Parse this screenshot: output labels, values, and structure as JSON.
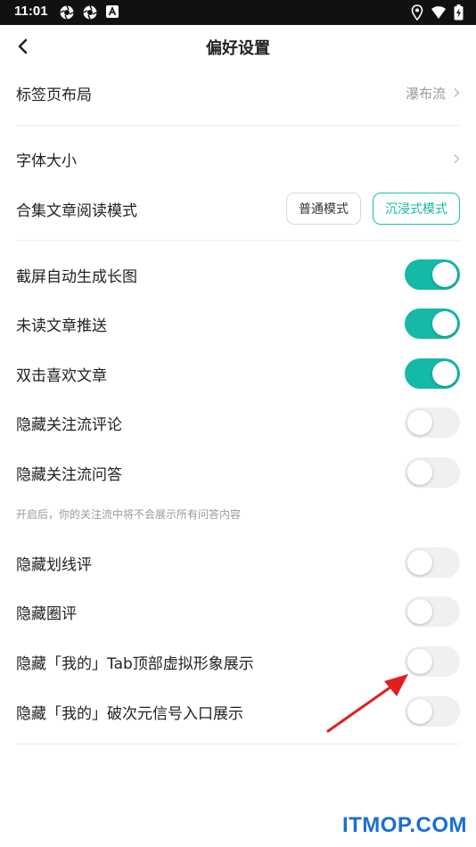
{
  "status_bar": {
    "time": "11:01",
    "left_icons": [
      "aperture-icon",
      "aperture-icon",
      "notification-a-icon"
    ],
    "right_icons": [
      "location-icon",
      "wifi-icon",
      "battery-charging-icon"
    ]
  },
  "header": {
    "title": "偏好设置",
    "back_icon": "chevron-left-icon"
  },
  "settings": {
    "tab_layout": {
      "label": "标签页布局",
      "value": "瀑布流"
    },
    "font_size": {
      "label": "字体大小"
    },
    "collection_mode": {
      "label": "合集文章阅读模式",
      "option_normal": "普通模式",
      "option_immersive": "沉浸式模式",
      "selected": "沉浸式模式"
    },
    "toggles": [
      {
        "label": "截屏自动生成长图",
        "on": true
      },
      {
        "label": "未读文章推送",
        "on": true
      },
      {
        "label": "双击喜欢文章",
        "on": true
      },
      {
        "label": "隐藏关注流评论",
        "on": false
      },
      {
        "label": "隐藏关注流问答",
        "on": false
      },
      {
        "label": "隐藏划线评",
        "on": false
      },
      {
        "label": "隐藏圈评",
        "on": false
      },
      {
        "label": "隐藏「我的」Tab顶部虚拟形象展示",
        "on": false
      },
      {
        "label": "隐藏「我的」破次元信号入口展示",
        "on": false
      }
    ],
    "qa_hint": "开启后，你的关注流中将不会展示所有问答内容"
  },
  "colors": {
    "accent": "#15b9a7",
    "annotation_arrow": "#e02020",
    "watermark": "#1a6fd0"
  },
  "watermark": "ITMOP.COM"
}
